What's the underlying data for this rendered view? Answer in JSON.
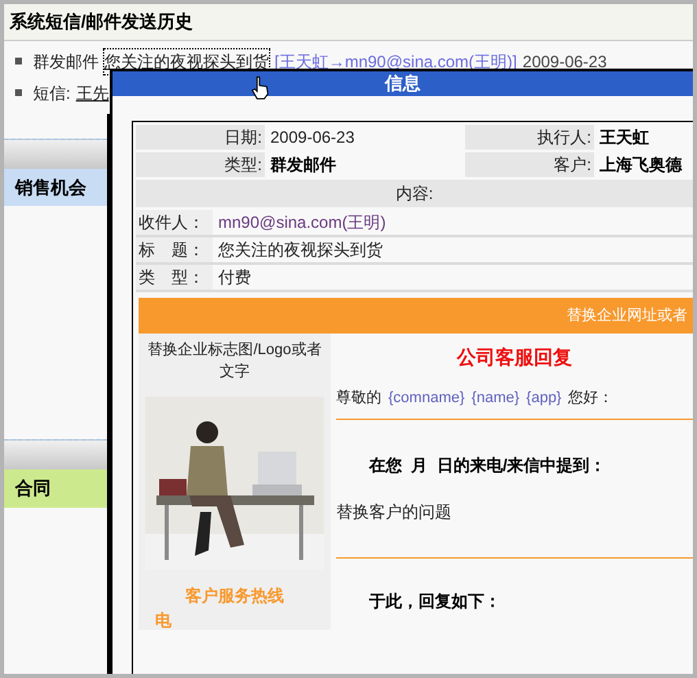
{
  "page_title": "系统短信/邮件发送历史",
  "history": [
    {
      "kind": "mail",
      "type": "群发邮件",
      "subject": "您关注的夜视探头到货",
      "route": "[王天虹→mn90@sina.com(王明)]",
      "date": "2009-06-23"
    },
    {
      "kind": "sms",
      "type": "短信:",
      "subject": "王先"
    }
  ],
  "sidebar": [
    {
      "label": "销售机会",
      "color": "#c8dcf4"
    },
    {
      "label": "合同",
      "color": "#cde98e"
    }
  ],
  "dialog": {
    "title": "信息",
    "fields": [
      {
        "label": "日期:",
        "value": "2009-06-23",
        "bold": false
      },
      {
        "label": "执行人:",
        "value": "王天虹",
        "bold": true
      },
      {
        "label": "类型:",
        "value": "群发邮件",
        "bold": true
      },
      {
        "label": "客户:",
        "value": "上海飞奥德",
        "bold": true
      }
    ],
    "content_label": "内容:",
    "meta": [
      {
        "label": "收件人：",
        "value": "mn90@sina.com(王明)"
      },
      {
        "label": "标　题：",
        "value": "您关注的夜视探头到货"
      },
      {
        "label": "类　型：",
        "value": "付费"
      }
    ],
    "banner": "替换企业网址或者",
    "logo_text": "替换企业标志图/Logo或者文字",
    "hotline": "客户服务热线",
    "hotline_cut": "电",
    "heading": "公司客服回复",
    "greeting": {
      "prefix": "尊敬的",
      "tokens": [
        "{comname}",
        "{name}",
        "{app}"
      ],
      "suffix": "您好："
    },
    "mention": "在您  月  日的来电/来信中提到：",
    "question": "替换客户的问题",
    "reply": "于此，回复如下："
  }
}
